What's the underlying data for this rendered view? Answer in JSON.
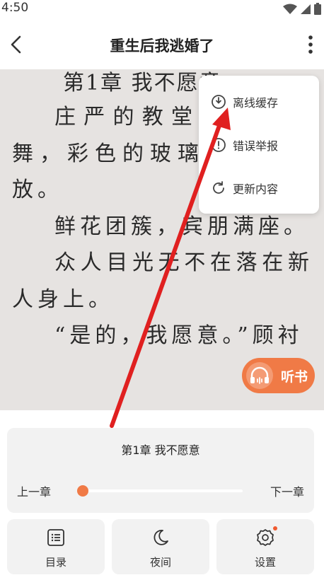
{
  "status_bar": {
    "time": "4:50"
  },
  "header": {
    "title": "重生后我逃婚了"
  },
  "reader": {
    "chapter_heading": "第1章 我不愿意",
    "paragraphs": [
      "庄严的教堂，白鸽飞舞，彩色的玻璃，玫瑰绽放。",
      "鲜花团簇，宾朋满座。",
      "众人目光无不在落在新人身上。",
      "“是的，我愿意。”顾衬"
    ]
  },
  "popup_menu": {
    "items": [
      {
        "label": "离线缓存",
        "icon": "download-clock-icon"
      },
      {
        "label": "错误举报",
        "icon": "error-report-icon"
      },
      {
        "label": "更新内容",
        "icon": "refresh-icon"
      }
    ]
  },
  "listen_button": {
    "label": "听书",
    "icon": "headphones-icon"
  },
  "bottom_panel": {
    "chapter_name": "第1章 我不愿意",
    "prev_label": "上一章",
    "next_label": "下一章",
    "progress": 0.0,
    "buttons": [
      {
        "label": "目录",
        "icon": "list-icon"
      },
      {
        "label": "夜间",
        "icon": "moon-icon"
      },
      {
        "label": "设置",
        "icon": "gear-icon",
        "has_badge": true
      }
    ]
  },
  "colors": {
    "accent": "#f07a46",
    "reading_bg": "#e6e3e1",
    "annotation_arrow": "#e02020"
  }
}
